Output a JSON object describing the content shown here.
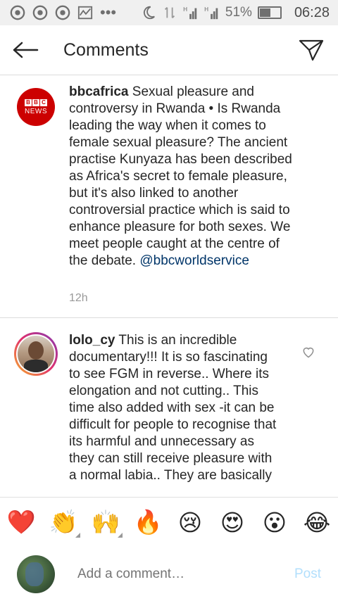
{
  "status_bar": {
    "battery": "51%",
    "time": "06:28"
  },
  "header": {
    "title": "Comments"
  },
  "post": {
    "username": "bbcafrica",
    "caption": "Sexual pleasure and controversy in Rwanda • Is Rwanda leading the way when it comes to female sexual pleasure? The ancient practise Kunyaza has been described as Africa's secret to female pleasure, but it's also linked to another controversial practice which is said to enhance pleasure for both sexes. We meet people caught at the centre of the debate.",
    "mention": "@bbcworldservice",
    "time": "12h",
    "avatar_text": [
      "B",
      "B",
      "C"
    ],
    "avatar_sub": "NEWS"
  },
  "comment": {
    "username": "lolo_cy",
    "text": "This is an incredible documentary!!! It is so fascinating to see FGM in reverse.. Where its elongation and not cutting.. This time also added with sex -it can be difficult for people to recognise that its harmful and unnecessary as they can still receive pleasure with a normal labia.. They are basically"
  },
  "emoji_bar": {
    "items": [
      "❤️",
      "👏",
      "🙌",
      "🔥",
      "😢",
      "😍",
      "😮",
      "😂"
    ]
  },
  "add_comment": {
    "placeholder": "Add a comment…",
    "post_label": "Post"
  },
  "colors": {
    "mention": "#003569",
    "post_disabled": "#b2dffc",
    "bbc_red": "#cc0000"
  }
}
